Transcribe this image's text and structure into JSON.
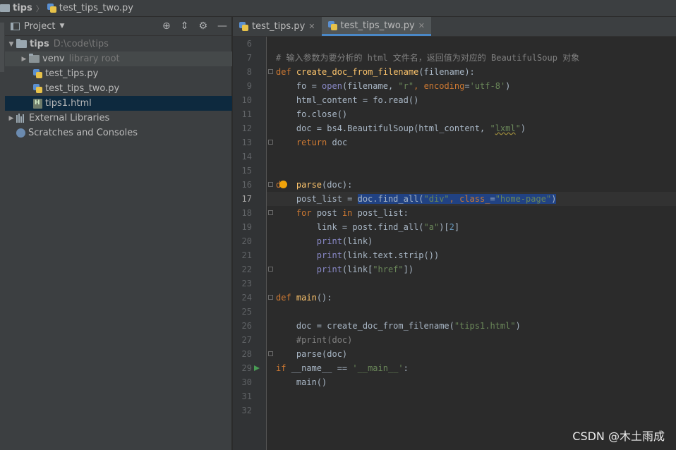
{
  "breadcrumb": {
    "root": "tips",
    "file": "test_tips_two.py"
  },
  "project_panel": {
    "title": "Project",
    "tree": [
      {
        "name": "tips",
        "hint": "D:\\code\\tips"
      },
      {
        "name": "venv",
        "hint": "library root"
      },
      {
        "name": "test_tips.py"
      },
      {
        "name": "test_tips_two.py"
      },
      {
        "name": "tips1.html"
      },
      {
        "name": "External Libraries"
      },
      {
        "name": "Scratches and Consoles"
      }
    ]
  },
  "tabs": [
    {
      "label": "test_tips.py"
    },
    {
      "label": "test_tips_two.py"
    }
  ],
  "editor": {
    "current_line": 17,
    "line_numbers": [
      "6",
      "7",
      "8",
      "9",
      "10",
      "11",
      "12",
      "13",
      "14",
      "15",
      "16",
      "17",
      "18",
      "19",
      "20",
      "21",
      "22",
      "23",
      "24",
      "25",
      "26",
      "27",
      "28",
      "29",
      "30",
      "31",
      "32"
    ],
    "code": {
      "l7_comment": "# 输入参数为要分析的 html 文件名，返回值为对应的 BeautifulSoup 对象",
      "l8_def": "def",
      "l8_name": "create_doc_from_filename",
      "l8_rest": "(filename):",
      "l9_a": "fo = ",
      "l9_open": "open",
      "l9_b": "(filename, ",
      "l9_r": "\"r\"",
      "l9_c": ", ",
      "l9_enc": "encoding",
      "l9_d": "=",
      "l9_utf": "'utf-8'",
      "l9_e": ")",
      "l10": "html_content = fo.read()",
      "l11": "fo.close()",
      "l12_a": "doc = bs4.BeautifulSoup(html_content, ",
      "l12_lxml_q1": "\"",
      "l12_lxml": "lxml",
      "l12_lxml_q2": "\"",
      "l12_b": ")",
      "l13_kw": "return",
      "l13_rest": " doc",
      "l16_kw": "de",
      "l16_name": "parse",
      "l16_rest": "(doc):",
      "l17_a": "post_list = ",
      "l17_sel_a": "doc.find_all(",
      "l17_sel_div": "\"div\"",
      "l17_sel_b": ", ",
      "l17_sel_cls": "class_",
      "l17_sel_c": "=",
      "l17_sel_hp": "\"home-page\"",
      "l17_sel_d": ")",
      "l18_for": "for",
      "l18_a": " post ",
      "l18_in": "in",
      "l18_b": " post_list:",
      "l19_a": "link = post.find_all(",
      "l19_s": "\"a\"",
      "l19_b": ")[",
      "l19_n": "2",
      "l19_c": "]",
      "l20_p": "print",
      "l20_r": "(link)",
      "l21_p": "print",
      "l21_r": "(link.text.strip())",
      "l22_p": "print",
      "l22_a": "(link[",
      "l22_s": "\"href\"",
      "l22_b": "])",
      "l24_def": "def",
      "l24_name": "main",
      "l24_rest": "():",
      "l26_a": "doc = create_doc_from_filename(",
      "l26_s": "\"tips1.html\"",
      "l26_b": ")",
      "l27": "#print(doc)",
      "l28": "parse(doc)",
      "l29_if": "if",
      "l29_sp": " ",
      "l29_nm": "__name__",
      "l29_eq": " == ",
      "l29_s": "'__main__'",
      "l29_c": ":",
      "l30": "main()"
    }
  },
  "watermark": "CSDN @木土雨成",
  "colors": {
    "background": "#2b2b2b",
    "panel": "#3c3f41",
    "selection": "#214283",
    "keyword": "#cc7832",
    "function": "#ffc66d",
    "string": "#6a8759"
  }
}
